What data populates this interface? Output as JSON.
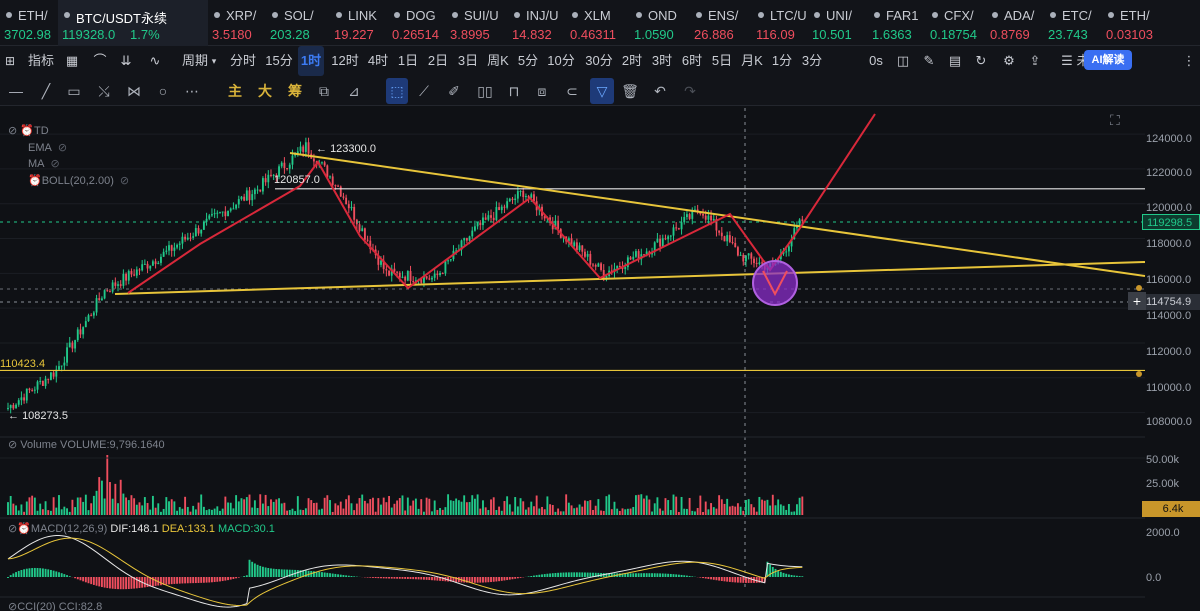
{
  "tickers": [
    {
      "sym": "ETH/",
      "price": "3702.98",
      "dir": "up"
    },
    {
      "sym": "BTC/USDT永续",
      "price": "119328.0",
      "change": "1.7%",
      "dir": "up",
      "active": true
    },
    {
      "sym": "XRP/",
      "price": "3.5180",
      "dir": "dn"
    },
    {
      "sym": "SOL/",
      "price": "203.28",
      "dir": "up"
    },
    {
      "sym": "LINK",
      "price": "19.227",
      "dir": "dn"
    },
    {
      "sym": "DOG",
      "price": "0.26514",
      "dir": "dn"
    },
    {
      "sym": "SUI/U",
      "price": "3.8995",
      "dir": "dn"
    },
    {
      "sym": "INJ/U",
      "price": "14.832",
      "dir": "dn"
    },
    {
      "sym": "XLM",
      "price": "0.46311",
      "dir": "dn"
    },
    {
      "sym": "OND",
      "price": "1.0590",
      "dir": "up"
    },
    {
      "sym": "ENS/",
      "price": "26.886",
      "dir": "dn"
    },
    {
      "sym": "LTC/U",
      "price": "116.09",
      "dir": "dn"
    },
    {
      "sym": "UNI/",
      "price": "10.501",
      "dir": "up"
    },
    {
      "sym": "FAR1",
      "price": "1.6363",
      "dir": "up"
    },
    {
      "sym": "CFX/",
      "price": "0.18754",
      "dir": "up"
    },
    {
      "sym": "ADA/",
      "price": "0.8769",
      "dir": "dn"
    },
    {
      "sym": "ETC/",
      "price": "23.743",
      "dir": "up"
    },
    {
      "sym": "ETH/",
      "price": "0.03103",
      "dir": "dn"
    }
  ],
  "toolbar": {
    "indicator_label": "指标",
    "period_label": "周期",
    "timeframes": [
      "分时",
      "15分",
      "1时",
      "12时",
      "4时",
      "1日",
      "2日",
      "3日",
      "周K",
      "5分",
      "10分",
      "30分",
      "2时",
      "3时",
      "6时",
      "5日",
      "月K",
      "1分",
      "3分"
    ],
    "selected_timeframe": "1时",
    "countdown": "0s",
    "layout_name": "未命名",
    "ai_button": "AI解读"
  },
  "drawtools": {
    "main": "主",
    "big": "大",
    "chip": "筹"
  },
  "indicators": {
    "td": "TD",
    "ema": "EMA",
    "ma": "MA",
    "boll": "BOLL(20,2.00)"
  },
  "price_axis": [
    "124000.0",
    "122000.0",
    "120000.0",
    "118000.0",
    "116000.0",
    "114000.0",
    "112000.0",
    "110000.0",
    "108000.0"
  ],
  "price_tags": {
    "current": "119298.5",
    "crosshair": "114754.9",
    "high": "123300.0",
    "level_a": "120857.0",
    "level_b": "110423.4",
    "low": "108273.5"
  },
  "volume": {
    "label": "Volume",
    "value_label": "VOLUME:9,796.1640",
    "axis_top": "50.00k",
    "axis_mid": "25.00k",
    "current": "6.4k"
  },
  "macd": {
    "label": "MACD(12,26,9)",
    "dif": "DIF:148.1",
    "dea": "DEA:133.1",
    "macd": "MACD:30.1",
    "axis_top": "2000.0",
    "axis_zero": "0.0"
  },
  "cci": {
    "label": "CCI(20)",
    "value": "CCI:82.8"
  },
  "chart_data": {
    "type": "candlestick",
    "symbol": "BTC/USDT永续",
    "interval": "1时",
    "ylim": [
      107000,
      125500
    ],
    "swing_points": [
      108273.5,
      110423.4,
      115000,
      117300,
      119000,
      120857,
      123300,
      121000,
      116000,
      115700,
      118500,
      120700,
      118200,
      116000,
      117500,
      119700,
      117000,
      116300,
      119300,
      121800,
      124800
    ],
    "resistance_line": [
      123000,
      116300
    ],
    "support_line": [
      115200,
      117000
    ],
    "horizontal_levels": [
      120857,
      110423.4
    ]
  },
  "colors": {
    "up": "#21c98a",
    "down": "#ef4e5e",
    "yellow_line": "#e8c53a",
    "red_line": "#d8283a",
    "circle": "#8a2cc8"
  }
}
